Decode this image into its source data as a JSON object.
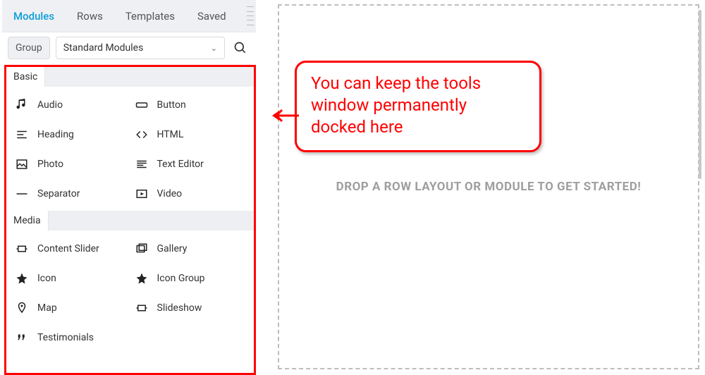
{
  "tabs": {
    "modules": "Modules",
    "rows": "Rows",
    "templates": "Templates",
    "saved": "Saved"
  },
  "filter": {
    "group_label": "Group",
    "selected": "Standard Modules"
  },
  "sections": {
    "basic": {
      "title": "Basic",
      "items": [
        {
          "label": "Audio",
          "icon": "audio-icon"
        },
        {
          "label": "Button",
          "icon": "button-icon"
        },
        {
          "label": "Heading",
          "icon": "heading-icon"
        },
        {
          "label": "HTML",
          "icon": "html-icon"
        },
        {
          "label": "Photo",
          "icon": "photo-icon"
        },
        {
          "label": "Text Editor",
          "icon": "text-editor-icon"
        },
        {
          "label": "Separator",
          "icon": "separator-icon"
        },
        {
          "label": "Video",
          "icon": "video-icon"
        }
      ]
    },
    "media": {
      "title": "Media",
      "items": [
        {
          "label": "Content Slider",
          "icon": "slider-icon"
        },
        {
          "label": "Gallery",
          "icon": "gallery-icon"
        },
        {
          "label": "Icon",
          "icon": "star-icon"
        },
        {
          "label": "Icon Group",
          "icon": "star-icon"
        },
        {
          "label": "Map",
          "icon": "pin-icon"
        },
        {
          "label": "Slideshow",
          "icon": "slideshow-icon"
        },
        {
          "label": "Testimonials",
          "icon": "quote-icon"
        }
      ]
    }
  },
  "canvas": {
    "placeholder": "DROP A ROW LAYOUT OR MODULE TO GET STARTED!"
  },
  "callout": {
    "text": "You can keep the tools window permanently docked here"
  }
}
